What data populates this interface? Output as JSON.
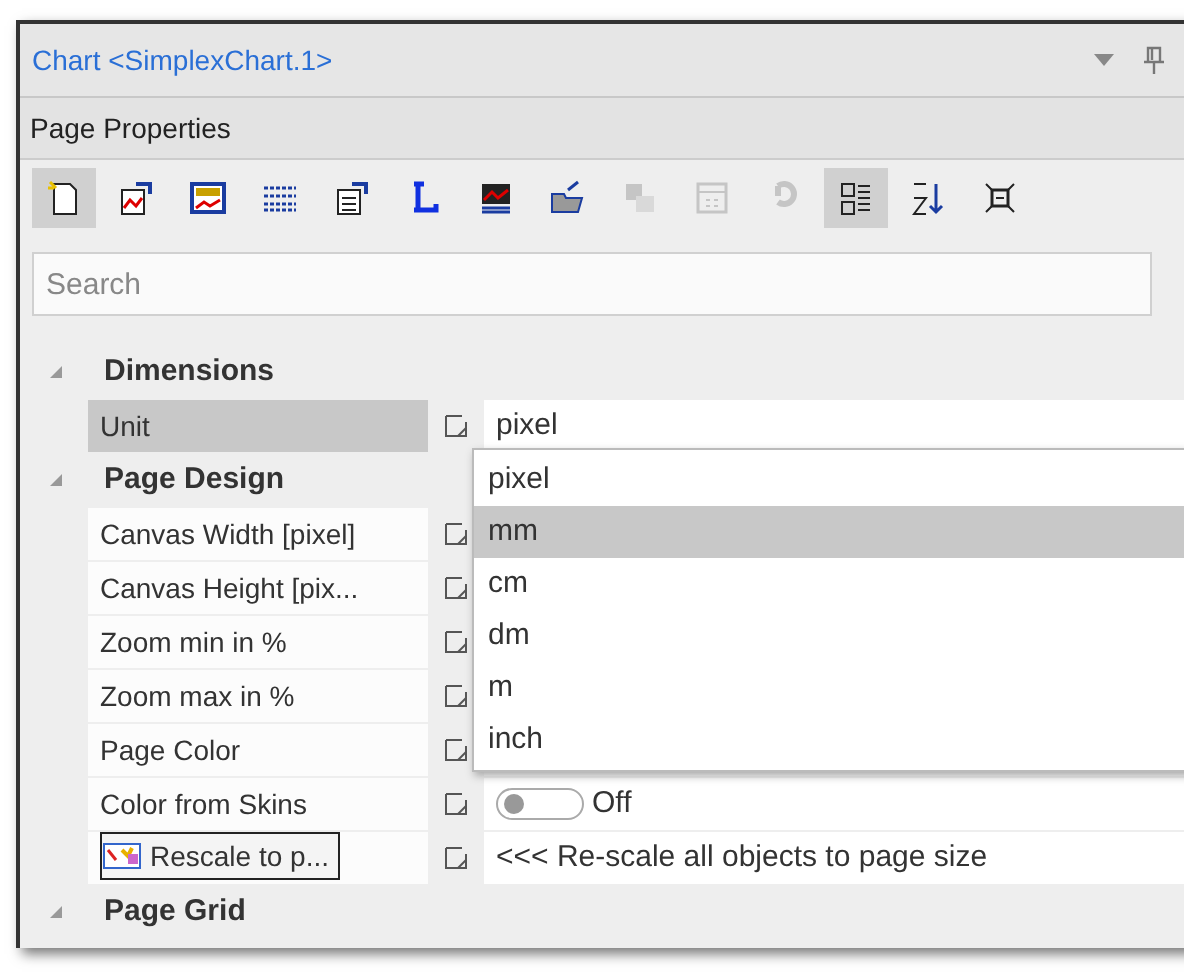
{
  "window": {
    "title": "Chart <SimplexChart.1>"
  },
  "section_title": "Page Properties",
  "toolbar": [
    {
      "selected": true,
      "disabled": false
    },
    {
      "selected": false,
      "disabled": false
    },
    {
      "selected": false,
      "disabled": false
    },
    {
      "selected": false,
      "disabled": false
    },
    {
      "selected": false,
      "disabled": false
    },
    {
      "selected": false,
      "disabled": false
    },
    {
      "selected": false,
      "disabled": false
    },
    {
      "selected": false,
      "disabled": false
    },
    {
      "selected": false,
      "disabled": true
    },
    {
      "selected": false,
      "disabled": true
    },
    {
      "selected": false,
      "disabled": true
    },
    {
      "selected": true,
      "disabled": false
    },
    {
      "selected": false,
      "disabled": false
    },
    {
      "selected": false,
      "disabled": false
    }
  ],
  "search": {
    "placeholder": "Search"
  },
  "categories": [
    {
      "name": "Dimensions",
      "expanded": true,
      "children": [
        {
          "label": "Unit",
          "kind": "dropdown",
          "value": "pixel",
          "selected": true
        }
      ]
    },
    {
      "name": "Page Design",
      "expanded": true,
      "children": [
        {
          "label": "Canvas Width [pixel]",
          "kind": "text",
          "selected": false
        },
        {
          "label": "Canvas Height [pix...",
          "kind": "text",
          "selected": false
        },
        {
          "label": "Zoom min in %",
          "kind": "text",
          "selected": false
        },
        {
          "label": "Zoom max in %",
          "kind": "text",
          "selected": false
        },
        {
          "label": "Page Color",
          "kind": "text",
          "selected": false
        },
        {
          "label": "Color from Skins",
          "kind": "toggle",
          "on": false,
          "value": "Off",
          "selected": false
        },
        {
          "label": "Rescale to p...",
          "kind": "action",
          "value": "<<< Re-scale all objects to page size"
        }
      ]
    },
    {
      "name": "Page Grid",
      "expanded": true
    }
  ],
  "dropdown": {
    "options": [
      {
        "label": "pixel",
        "selected": false
      },
      {
        "label": "mm",
        "selected": true
      },
      {
        "label": "cm",
        "selected": false
      },
      {
        "label": "dm",
        "selected": false
      },
      {
        "label": "m",
        "selected": false
      },
      {
        "label": "inch",
        "selected": false
      }
    ]
  }
}
